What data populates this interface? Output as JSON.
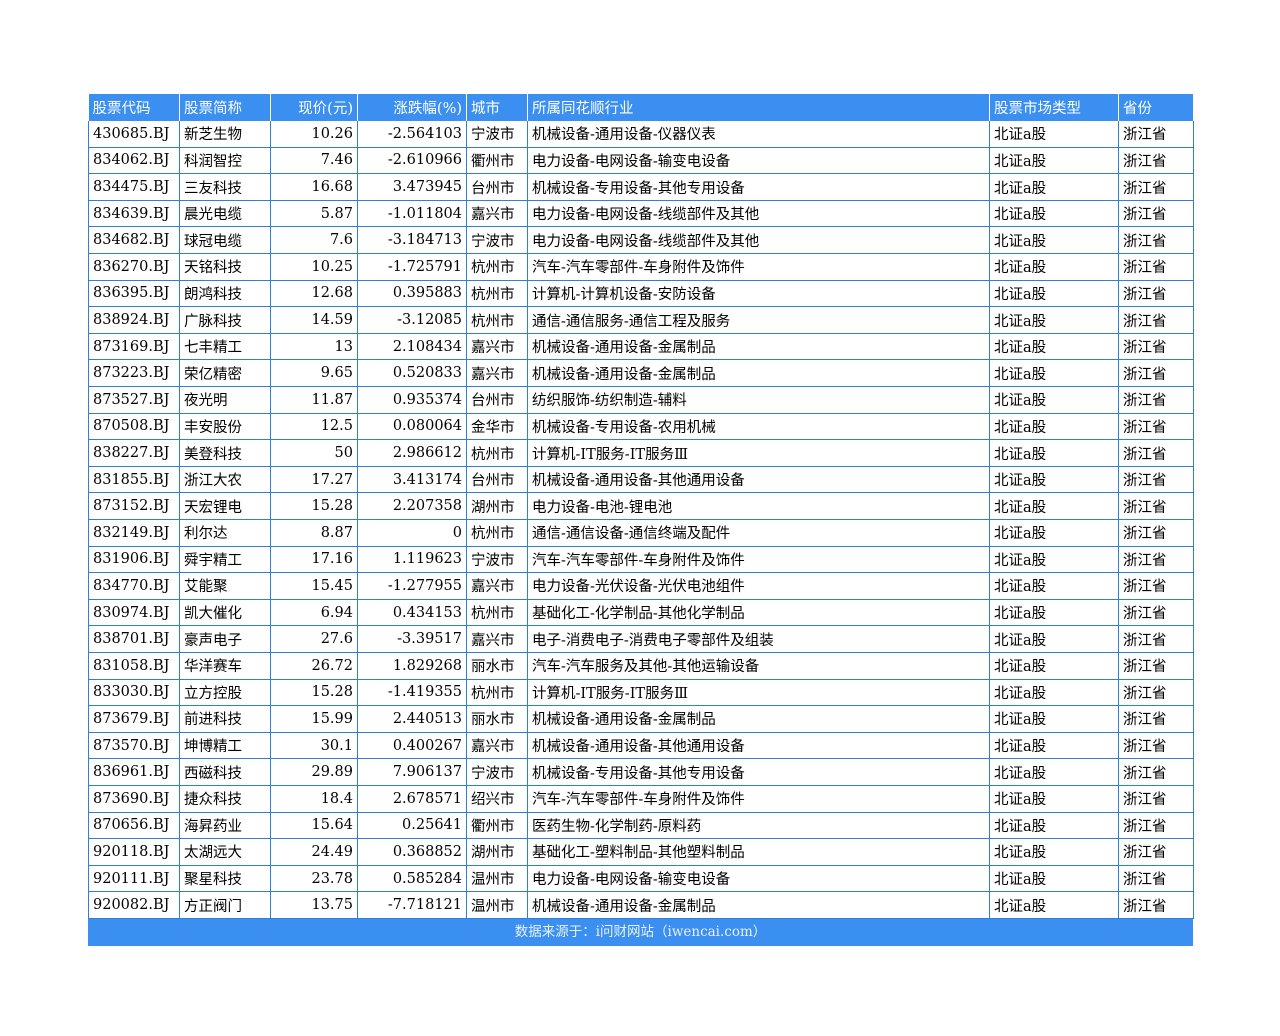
{
  "headers": [
    "股票代码",
    "股票简称",
    "现价(元)",
    "涨跌幅(%)",
    "城市",
    "所属同花顺行业",
    "股票市场类型",
    "省份"
  ],
  "rows": [
    [
      "430685.BJ",
      "新芝生物",
      "10.26",
      "-2.564103",
      "宁波市",
      "机械设备-通用设备-仪器仪表",
      "北证a股",
      "浙江省"
    ],
    [
      "834062.BJ",
      "科润智控",
      "7.46",
      "-2.610966",
      "衢州市",
      "电力设备-电网设备-输变电设备",
      "北证a股",
      "浙江省"
    ],
    [
      "834475.BJ",
      "三友科技",
      "16.68",
      "3.473945",
      "台州市",
      "机械设备-专用设备-其他专用设备",
      "北证a股",
      "浙江省"
    ],
    [
      "834639.BJ",
      "晨光电缆",
      "5.87",
      "-1.011804",
      "嘉兴市",
      "电力设备-电网设备-线缆部件及其他",
      "北证a股",
      "浙江省"
    ],
    [
      "834682.BJ",
      "球冠电缆",
      "7.6",
      "-3.184713",
      "宁波市",
      "电力设备-电网设备-线缆部件及其他",
      "北证a股",
      "浙江省"
    ],
    [
      "836270.BJ",
      "天铭科技",
      "10.25",
      "-1.725791",
      "杭州市",
      "汽车-汽车零部件-车身附件及饰件",
      "北证a股",
      "浙江省"
    ],
    [
      "836395.BJ",
      "朗鸿科技",
      "12.68",
      "0.395883",
      "杭州市",
      "计算机-计算机设备-安防设备",
      "北证a股",
      "浙江省"
    ],
    [
      "838924.BJ",
      "广脉科技",
      "14.59",
      "-3.12085",
      "杭州市",
      "通信-通信服务-通信工程及服务",
      "北证a股",
      "浙江省"
    ],
    [
      "873169.BJ",
      "七丰精工",
      "13",
      "2.108434",
      "嘉兴市",
      "机械设备-通用设备-金属制品",
      "北证a股",
      "浙江省"
    ],
    [
      "873223.BJ",
      "荣亿精密",
      "9.65",
      "0.520833",
      "嘉兴市",
      "机械设备-通用设备-金属制品",
      "北证a股",
      "浙江省"
    ],
    [
      "873527.BJ",
      "夜光明",
      "11.87",
      "0.935374",
      "台州市",
      "纺织服饰-纺织制造-辅料",
      "北证a股",
      "浙江省"
    ],
    [
      "870508.BJ",
      "丰安股份",
      "12.5",
      "0.080064",
      "金华市",
      "机械设备-专用设备-农用机械",
      "北证a股",
      "浙江省"
    ],
    [
      "838227.BJ",
      "美登科技",
      "50",
      "2.986612",
      "杭州市",
      "计算机-IT服务-IT服务Ⅲ",
      "北证a股",
      "浙江省"
    ],
    [
      "831855.BJ",
      "浙江大农",
      "17.27",
      "3.413174",
      "台州市",
      "机械设备-通用设备-其他通用设备",
      "北证a股",
      "浙江省"
    ],
    [
      "873152.BJ",
      "天宏锂电",
      "15.28",
      "2.207358",
      "湖州市",
      "电力设备-电池-锂电池",
      "北证a股",
      "浙江省"
    ],
    [
      "832149.BJ",
      "利尔达",
      "8.87",
      "0",
      "杭州市",
      "通信-通信设备-通信终端及配件",
      "北证a股",
      "浙江省"
    ],
    [
      "831906.BJ",
      "舜宇精工",
      "17.16",
      "1.119623",
      "宁波市",
      "汽车-汽车零部件-车身附件及饰件",
      "北证a股",
      "浙江省"
    ],
    [
      "834770.BJ",
      "艾能聚",
      "15.45",
      "-1.277955",
      "嘉兴市",
      "电力设备-光伏设备-光伏电池组件",
      "北证a股",
      "浙江省"
    ],
    [
      "830974.BJ",
      "凯大催化",
      "6.94",
      "0.434153",
      "杭州市",
      "基础化工-化学制品-其他化学制品",
      "北证a股",
      "浙江省"
    ],
    [
      "838701.BJ",
      "豪声电子",
      "27.6",
      "-3.39517",
      "嘉兴市",
      "电子-消费电子-消费电子零部件及组装",
      "北证a股",
      "浙江省"
    ],
    [
      "831058.BJ",
      "华洋赛车",
      "26.72",
      "1.829268",
      "丽水市",
      "汽车-汽车服务及其他-其他运输设备",
      "北证a股",
      "浙江省"
    ],
    [
      "833030.BJ",
      "立方控股",
      "15.28",
      "-1.419355",
      "杭州市",
      "计算机-IT服务-IT服务Ⅲ",
      "北证a股",
      "浙江省"
    ],
    [
      "873679.BJ",
      "前进科技",
      "15.99",
      "2.440513",
      "丽水市",
      "机械设备-通用设备-金属制品",
      "北证a股",
      "浙江省"
    ],
    [
      "873570.BJ",
      "坤博精工",
      "30.1",
      "0.400267",
      "嘉兴市",
      "机械设备-通用设备-其他通用设备",
      "北证a股",
      "浙江省"
    ],
    [
      "836961.BJ",
      "西磁科技",
      "29.89",
      "7.906137",
      "宁波市",
      "机械设备-专用设备-其他专用设备",
      "北证a股",
      "浙江省"
    ],
    [
      "873690.BJ",
      "捷众科技",
      "18.4",
      "2.678571",
      "绍兴市",
      "汽车-汽车零部件-车身附件及饰件",
      "北证a股",
      "浙江省"
    ],
    [
      "870656.BJ",
      "海昇药业",
      "15.64",
      "0.25641",
      "衢州市",
      "医药生物-化学制药-原料药",
      "北证a股",
      "浙江省"
    ],
    [
      "920118.BJ",
      "太湖远大",
      "24.49",
      "0.368852",
      "湖州市",
      "基础化工-塑料制品-其他塑料制品",
      "北证a股",
      "浙江省"
    ],
    [
      "920111.BJ",
      "聚星科技",
      "23.78",
      "0.585284",
      "温州市",
      "电力设备-电网设备-输变电设备",
      "北证a股",
      "浙江省"
    ],
    [
      "920082.BJ",
      "方正阀门",
      "13.75",
      "-7.718121",
      "温州市",
      "机械设备-通用设备-金属制品",
      "北证a股",
      "浙江省"
    ]
  ],
  "footer": "数据来源于：i问财网站（iwencai.com）",
  "colors": {
    "header_bg": "#3b8ff0",
    "grid": "#2f7fd6"
  }
}
